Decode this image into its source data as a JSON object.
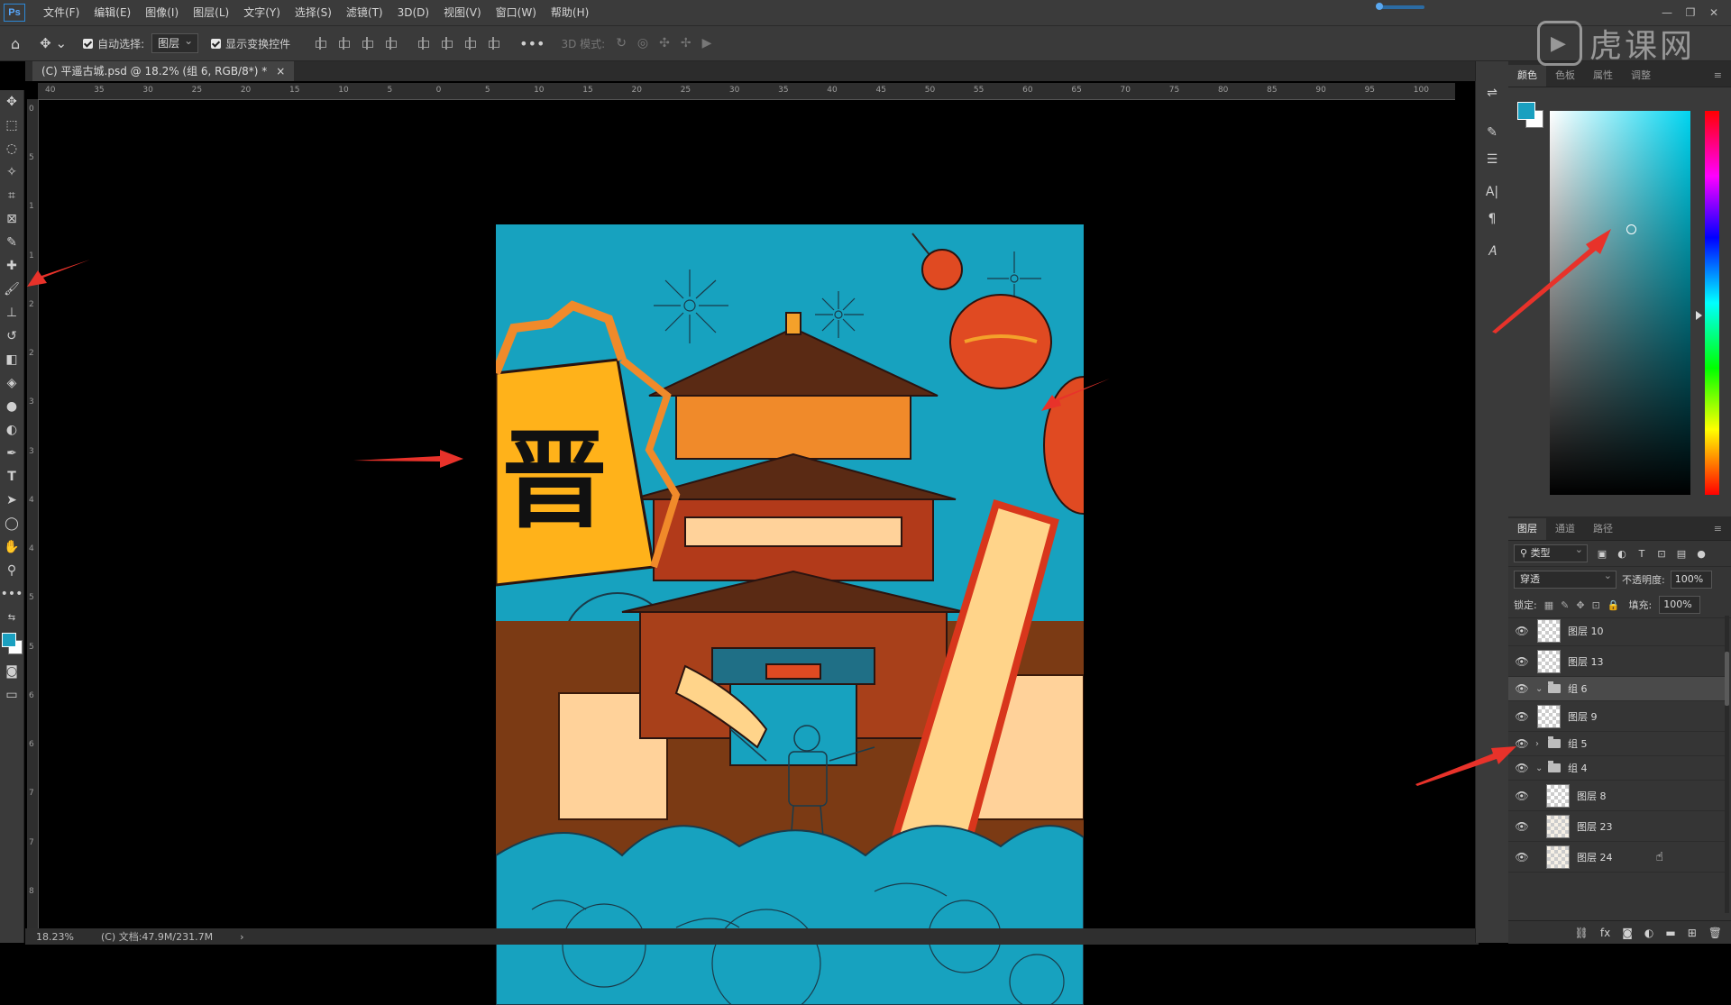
{
  "app": {
    "logo_text": "Ps"
  },
  "menu": [
    {
      "label": "文件(F)"
    },
    {
      "label": "编辑(E)"
    },
    {
      "label": "图像(I)"
    },
    {
      "label": "图层(L)"
    },
    {
      "label": "文字(Y)"
    },
    {
      "label": "选择(S)"
    },
    {
      "label": "滤镜(T)"
    },
    {
      "label": "3D(D)"
    },
    {
      "label": "视图(V)"
    },
    {
      "label": "窗口(W)"
    },
    {
      "label": "帮助(H)"
    }
  ],
  "watermark": {
    "text": "虎课网"
  },
  "options": {
    "auto_select_label": "自动选择:",
    "auto_select_value": "图层",
    "show_transform_label": "显示变换控件",
    "mode_3d_label": "3D 模式:"
  },
  "document": {
    "tab_title": "(C) 平遥古城.psd @ 18.2% (组 6, RGB/8*) *",
    "close_glyph": "×",
    "zoom": "18.23%",
    "doc_info": "(C) 文档:47.9M/231.7M"
  },
  "ruler_top": [
    "40",
    "35",
    "30",
    "25",
    "20",
    "15",
    "10",
    "5",
    "0",
    "5",
    "10",
    "15",
    "20",
    "25",
    "30",
    "35",
    "40",
    "45",
    "50",
    "55",
    "60",
    "65",
    "70",
    "75",
    "80",
    "85",
    "90",
    "95",
    "100"
  ],
  "ruler_left": [
    "0",
    "5",
    "1",
    "1",
    "2",
    "2",
    "3",
    "3",
    "4",
    "4",
    "5",
    "5",
    "6",
    "6",
    "7",
    "7",
    "8"
  ],
  "artwork": {
    "banner_character": "晋"
  },
  "colors": {
    "foreground": "#1aa0c0",
    "background": "#ffffff",
    "accent_arrow": "#e8322a"
  },
  "color_panel": {
    "tabs": [
      "颜色",
      "色板",
      "属性",
      "调整"
    ]
  },
  "layers_panel": {
    "tabs": [
      "图层",
      "通道",
      "路径"
    ],
    "filter_kind": "类型",
    "blend_mode": "穿透",
    "opacity_label": "不透明度:",
    "opacity_value": "100%",
    "lock_label": "锁定:",
    "fill_label": "填充:",
    "fill_value": "100%",
    "layers": [
      {
        "name": "图层 10",
        "type": "layer",
        "visible": true
      },
      {
        "name": "图层 13",
        "type": "layer",
        "visible": true
      },
      {
        "name": "组 6",
        "type": "group",
        "expanded": true,
        "selected": true,
        "visible": true
      },
      {
        "name": "图层 9",
        "type": "layer",
        "visible": true
      },
      {
        "name": "组 5",
        "type": "group",
        "expanded": false,
        "visible": true
      },
      {
        "name": "组 4",
        "type": "group",
        "expanded": true,
        "visible": true
      },
      {
        "name": "图层 8",
        "type": "layer",
        "indent": true,
        "visible": true
      },
      {
        "name": "图层 23",
        "type": "layer",
        "indent": true,
        "art": true,
        "visible": true
      },
      {
        "name": "图层 24",
        "type": "layer",
        "indent": true,
        "art": true,
        "visible": true
      }
    ]
  }
}
